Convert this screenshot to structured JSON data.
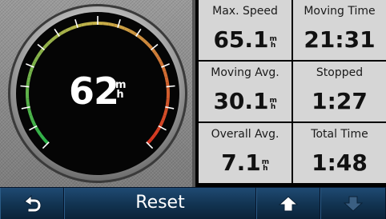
{
  "speedometer": {
    "current_speed": "62",
    "unit_top": "m",
    "unit_bottom": "h",
    "gauge_colors": {
      "green": "#2bb24a",
      "amber": "#c9b24a",
      "red": "#d6321f"
    }
  },
  "stats": [
    {
      "label": "Max. Speed",
      "value": "65.1",
      "unit_top": "m",
      "unit_bottom": "h"
    },
    {
      "label": "Moving Time",
      "value": "21:31"
    },
    {
      "label": "Moving Avg.",
      "value": "30.1",
      "unit_top": "m",
      "unit_bottom": "h"
    },
    {
      "label": "Stopped",
      "value": "1:27"
    },
    {
      "label": "Overall Avg.",
      "value": "7.1",
      "unit_top": "m",
      "unit_bottom": "h"
    },
    {
      "label": "Total Time",
      "value": "1:48"
    }
  ],
  "toolbar": {
    "back_icon": "back-arrow-icon",
    "reset_label": "Reset",
    "up_icon": "arrow-up-icon",
    "down_icon": "arrow-down-icon",
    "up_enabled": true,
    "down_enabled": false
  }
}
